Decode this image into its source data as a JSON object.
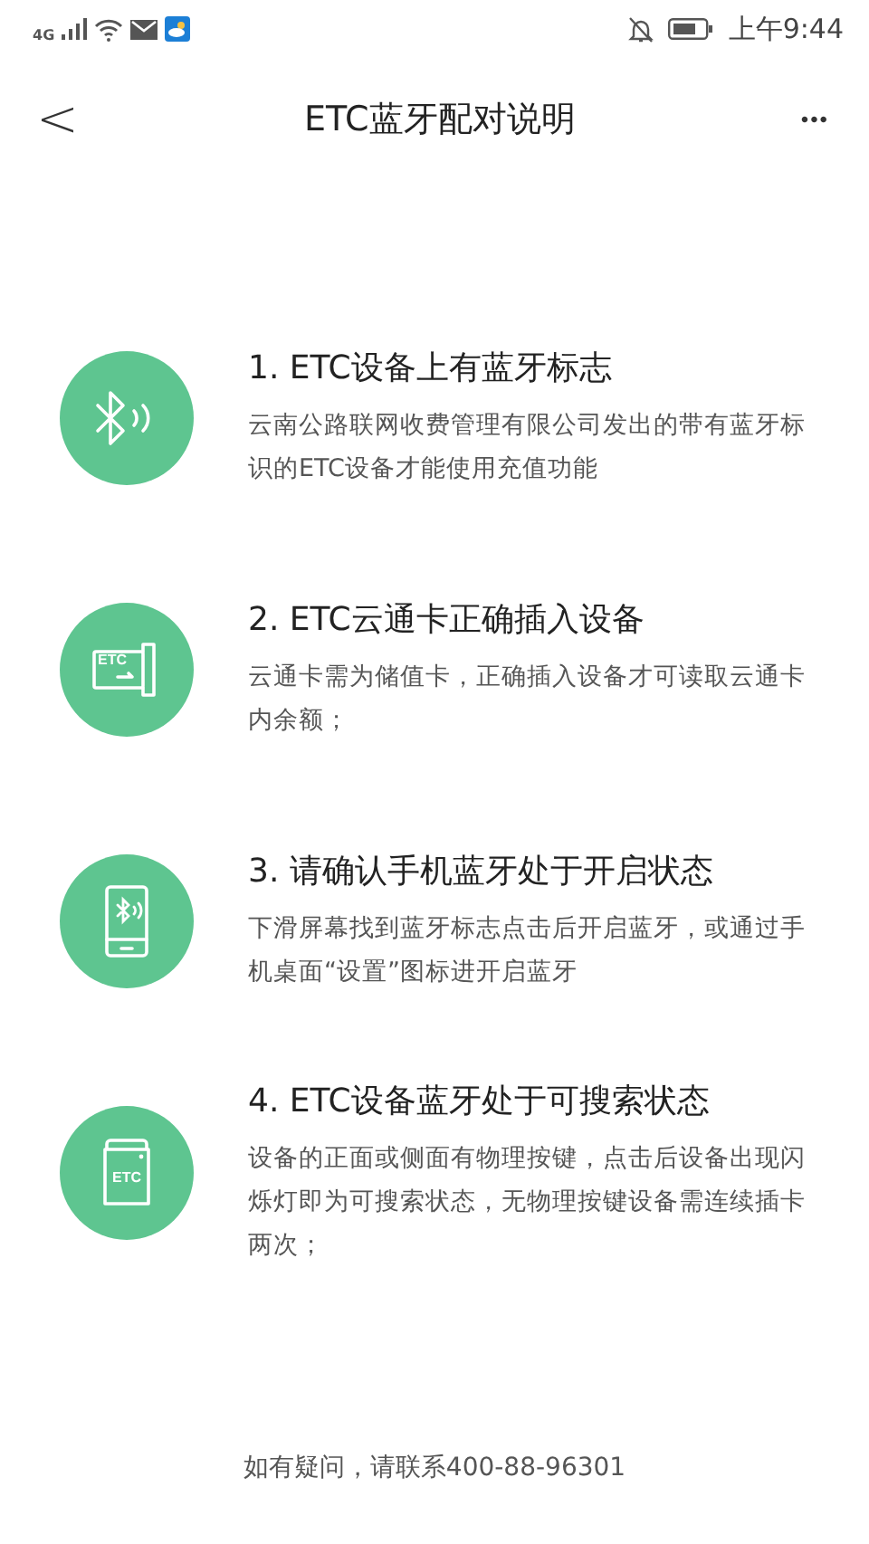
{
  "status_bar": {
    "network": "4G",
    "time": "上午9:44"
  },
  "header": {
    "back": "<",
    "title": "ETC蓝牙配对说明",
    "more": "•••"
  },
  "steps": [
    {
      "kind": "bluetooth",
      "title": "1. ETC设备上有蓝牙标志",
      "description": "云南公路联网收费管理有限公司发出的带有蓝牙标识的ETC设备才能使用充值功能"
    },
    {
      "kind": "card",
      "icon_label": "ETC",
      "title": "2. ETC云通卡正确插入设备",
      "description": "云通卡需为储值卡，正确插入设备才可读取云通卡内余额；"
    },
    {
      "kind": "phone",
      "title": "3. 请确认手机蓝牙处于开启状态",
      "description": "下滑屏幕找到蓝牙标志点击后开启蓝牙，或通过手机桌面“设置”图标进开启蓝牙"
    },
    {
      "kind": "device",
      "icon_label": "ETC",
      "title": "4. ETC设备蓝牙处于可搜索状态",
      "description": "设备的正面或侧面有物理按键，点击后设备出现闪烁灯即为可搜索状态，无物理按键设备需连续插卡两次；"
    }
  ],
  "footer": "如有疑问，请联系400-88-96301"
}
